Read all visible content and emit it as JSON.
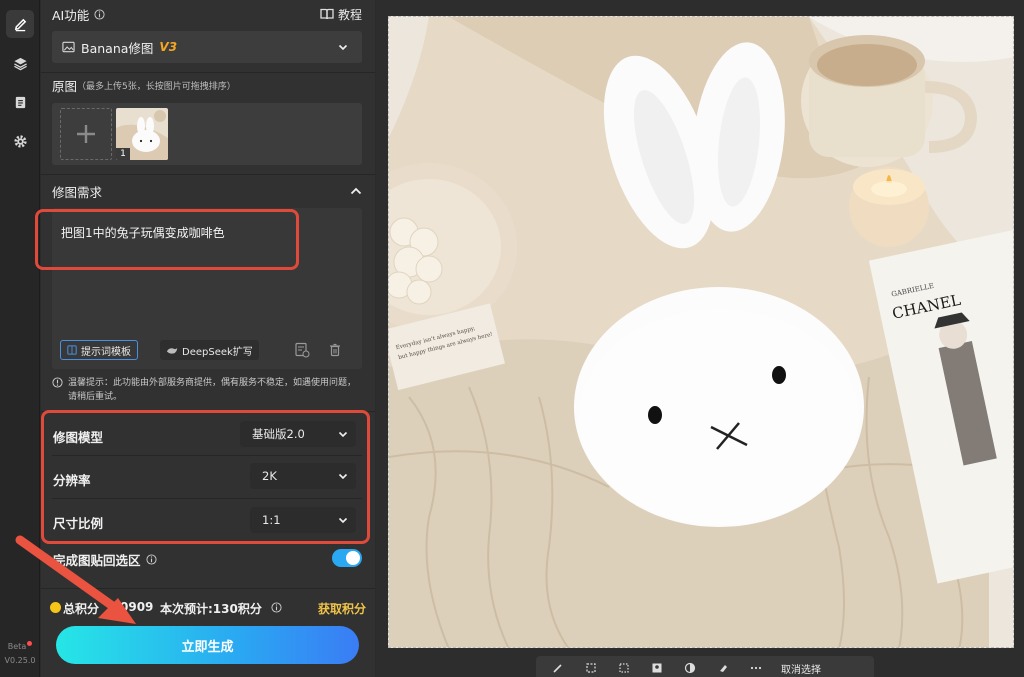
{
  "rail": {
    "items": [
      "edit-icon",
      "layers-icon",
      "document-icon",
      "gear-icon"
    ],
    "beta": "Beta",
    "version": "V0.25.0"
  },
  "ai": {
    "title": "AI功能",
    "tutorial": "教程",
    "model_name": "Banana修图",
    "model_version": "V3"
  },
  "source": {
    "title": "原图",
    "hint": "（最多上传5张，长按图片可拖拽排序）",
    "thumb_index": "1"
  },
  "request": {
    "title": "修图需求",
    "text": "把图1中的兔子玩偶变成咖啡色",
    "template_btn": "提示词模板",
    "deepseek_btn": "DeepSeek扩写",
    "notice": "温馨提示：此功能由外部服务商提供，偶有服务不稳定，如遇使用问题，请稍后重试。"
  },
  "settings": {
    "model_label": "修图模型",
    "model_value": "基础版2.0",
    "resolution_label": "分辨率",
    "resolution_value": "2K",
    "ratio_label": "尺寸比例",
    "ratio_value": "1:1",
    "paste_back_label": "完成图贴回选区",
    "paste_back_on": true
  },
  "points": {
    "total_label": "总积分",
    "total_visible": "0909",
    "estimate": "本次预计:130积分",
    "get_points": "获取积分"
  },
  "generate_label": "立即生成",
  "canvas": {
    "toolbar_cancel": "取消选择",
    "book_brand": "CHANEL",
    "book_top": "GABRIELLE",
    "card_text": "Everyday isn't always happy, but happy things are always here!"
  },
  "colors": {
    "accent_cyan": "#26e6e6",
    "accent_blue": "#3a7cf5",
    "highlight_red": "#e04a3a",
    "link_yellow": "#f0c44a",
    "version_orange": "#f5a623"
  }
}
